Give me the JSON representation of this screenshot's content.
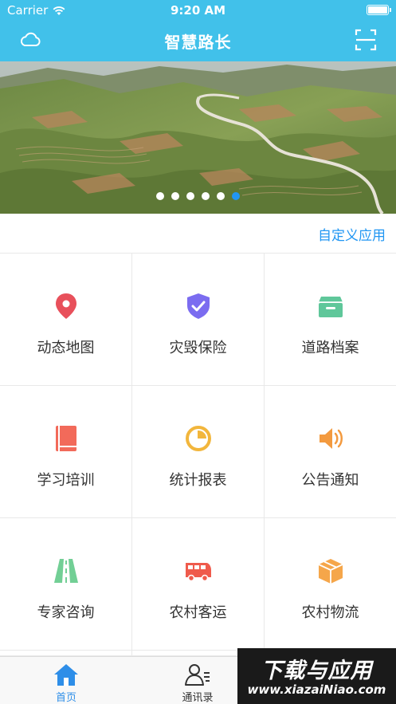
{
  "status_bar": {
    "carrier": "Carrier",
    "time": "9:20 AM"
  },
  "nav": {
    "title": "智慧路长",
    "left_icon": "cloud-icon",
    "right_icon": "scan-icon"
  },
  "banner": {
    "image": "aerial-terraced-hills",
    "page_count": 6,
    "active_page": 6
  },
  "custom_apps": {
    "label": "自定义应用"
  },
  "apps": [
    {
      "label": "动态地图",
      "icon": "map-pin-icon",
      "color": "#e8505b"
    },
    {
      "label": "灾毁保险",
      "icon": "shield-check-icon",
      "color": "#7b6cf0"
    },
    {
      "label": "道路档案",
      "icon": "archive-box-icon",
      "color": "#5fc79a"
    },
    {
      "label": "学习培训",
      "icon": "book-icon",
      "color": "#f26a5a"
    },
    {
      "label": "统计报表",
      "icon": "pie-chart-icon",
      "color": "#f2b63c"
    },
    {
      "label": "公告通知",
      "icon": "speaker-icon",
      "color": "#f39a3f"
    },
    {
      "label": "专家咨询",
      "icon": "road-icon",
      "color": "#72cf95"
    },
    {
      "label": "农村客运",
      "icon": "bus-icon",
      "color": "#ef5b4c"
    },
    {
      "label": "农村物流",
      "icon": "package-icon",
      "color": "#f5a64a"
    }
  ],
  "tabbar": {
    "tabs": [
      {
        "label": "首页",
        "icon": "home-icon",
        "active": true
      },
      {
        "label": "通讯录",
        "icon": "contacts-icon",
        "active": false
      }
    ]
  },
  "watermark": {
    "text": "下载与应用",
    "url": "www.xiazaiNiao.com"
  }
}
